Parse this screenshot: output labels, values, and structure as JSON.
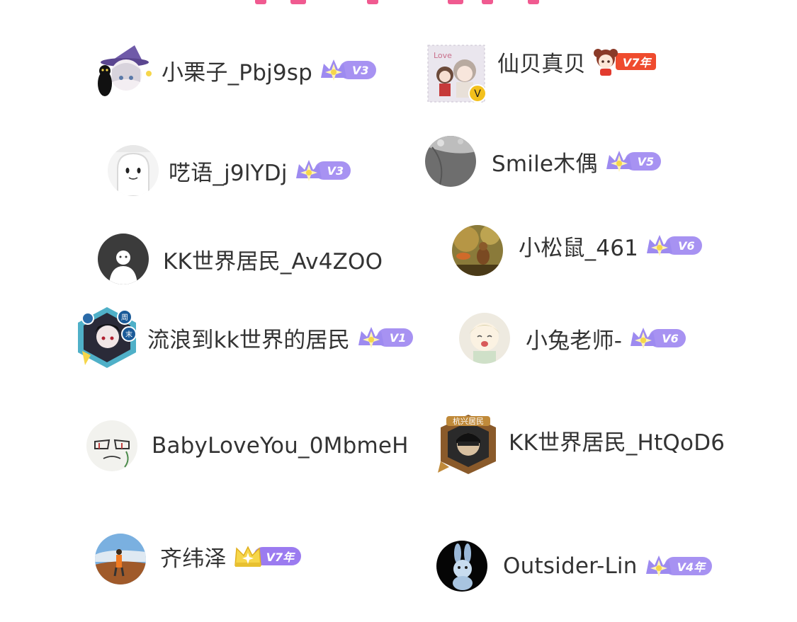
{
  "users": [
    {
      "name": "小栗子_Pbj9sp",
      "badge": "V3",
      "badge_style": "purple",
      "avatar_icon": "witch-girl-with-black-cat-avatar"
    },
    {
      "name": "仙贝真贝",
      "badge": "V7年",
      "badge_style": "orange-girl",
      "avatar_icon": "love-stamp-anime-avatar",
      "verified": "V"
    },
    {
      "name": "呓语_j9lYDj",
      "badge": "V3",
      "badge_style": "purple",
      "avatar_icon": "white-ghost-avatar"
    },
    {
      "name": "Smile木偶",
      "badge": "V5",
      "badge_style": "purple",
      "avatar_icon": "gray-fabric-avatar"
    },
    {
      "name": "KK世界居民_Av4ZOO",
      "badge": "",
      "badge_style": "none",
      "avatar_icon": "default-user-silhouette-avatar"
    },
    {
      "name": "小松鼠_461",
      "badge": "V6",
      "badge_style": "purple",
      "avatar_icon": "squirrel-photo-avatar"
    },
    {
      "name": "流浪到kk世界的居民",
      "badge": "V1",
      "badge_style": "purple",
      "avatar_icon": "weekend-frame-anime-avatar",
      "frame_text": "周末"
    },
    {
      "name": "小兔老师-",
      "badge": "V6",
      "badge_style": "purple",
      "avatar_icon": "smiling-cartoon-child-avatar"
    },
    {
      "name": "BabyLoveYou_0MbmeH",
      "badge": "",
      "badge_style": "none",
      "avatar_icon": "sketch-face-avatar"
    },
    {
      "name": "KK世界居民_HtQoD6",
      "badge": "",
      "badge_style": "none",
      "avatar_icon": "warrior-frame-avatar",
      "frame_text": "杭兴居民"
    },
    {
      "name": "齐纬泽",
      "badge": "V7年",
      "badge_style": "gold",
      "avatar_icon": "hiker-on-mountain-avatar"
    },
    {
      "name": "Outsider-Lin",
      "badge": "V4年",
      "badge_style": "purple",
      "avatar_icon": "blue-bunny-avatar"
    }
  ],
  "colors": {
    "name_text": "#333333",
    "badge_purple": "#a792f2",
    "badge_orange": "#ef4b2e",
    "crown_gold": "#f6d64a",
    "top_accent": "#f05a90"
  }
}
